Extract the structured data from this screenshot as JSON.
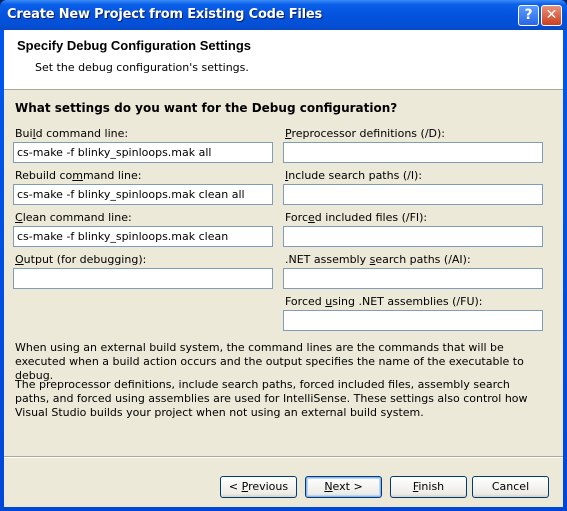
{
  "window": {
    "title": "Create New Project from Existing Code Files",
    "help_icon": "question-mark-icon",
    "close_icon": "close-x-icon"
  },
  "header": {
    "title": "Specify Debug Configuration Settings",
    "subtitle": "Set the debug configuration's settings."
  },
  "question": "What settings do you want for the Debug configuration?",
  "left_fields": [
    {
      "label_pre": "Bui",
      "label_ul": "l",
      "label_post": "d command line:",
      "value": "cs-make -f blinky_spinloops.mak all",
      "placeholder": ""
    },
    {
      "label_pre": "Rebuild co",
      "label_ul": "m",
      "label_post": "mand line:",
      "value": "cs-make -f blinky_spinloops.mak clean all",
      "placeholder": ""
    },
    {
      "label_pre": "",
      "label_ul": "C",
      "label_post": "lean command line:",
      "value": "cs-make -f blinky_spinloops.mak clean",
      "placeholder": ""
    },
    {
      "label_pre": "",
      "label_ul": "O",
      "label_post": "utput (for debugging):",
      "value": "",
      "placeholder": ""
    }
  ],
  "right_fields": [
    {
      "label_pre": "",
      "label_ul": "P",
      "label_post": "reprocessor definitions (/D):",
      "value": "",
      "placeholder": ""
    },
    {
      "label_pre": "",
      "label_ul": "I",
      "label_post": "nclude search paths (/I):",
      "value": "",
      "placeholder": ""
    },
    {
      "label_pre": "Forc",
      "label_ul": "e",
      "label_post": "d included files (/FI):",
      "value": "",
      "placeholder": ""
    },
    {
      "label_pre": ".NET assembly ",
      "label_ul": "s",
      "label_post": "earch paths (/AI):",
      "value": "",
      "placeholder": ""
    },
    {
      "label_pre": "Forced ",
      "label_ul": "u",
      "label_post": "sing .NET assemblies (/FU):",
      "value": "",
      "placeholder": ""
    }
  ],
  "notes": [
    "When using an external build system, the command lines are the commands that will be executed when a build action occurs and the output specifies the name of the executable to debug.",
    "The preprocessor definitions, include search paths, forced included files, assembly search paths, and forced using assemblies are used for IntelliSense.  These settings also control how Visual Studio builds your project when not using an external build system."
  ],
  "buttons": {
    "previous": {
      "pre": "< ",
      "ul": "P",
      "post": "revious"
    },
    "next": {
      "pre": "",
      "ul": "N",
      "post": "ext >"
    },
    "finish": {
      "pre": "",
      "ul": "F",
      "post": "inish"
    },
    "cancel": {
      "pre": "",
      "ul": "",
      "post": "Cancel"
    }
  }
}
